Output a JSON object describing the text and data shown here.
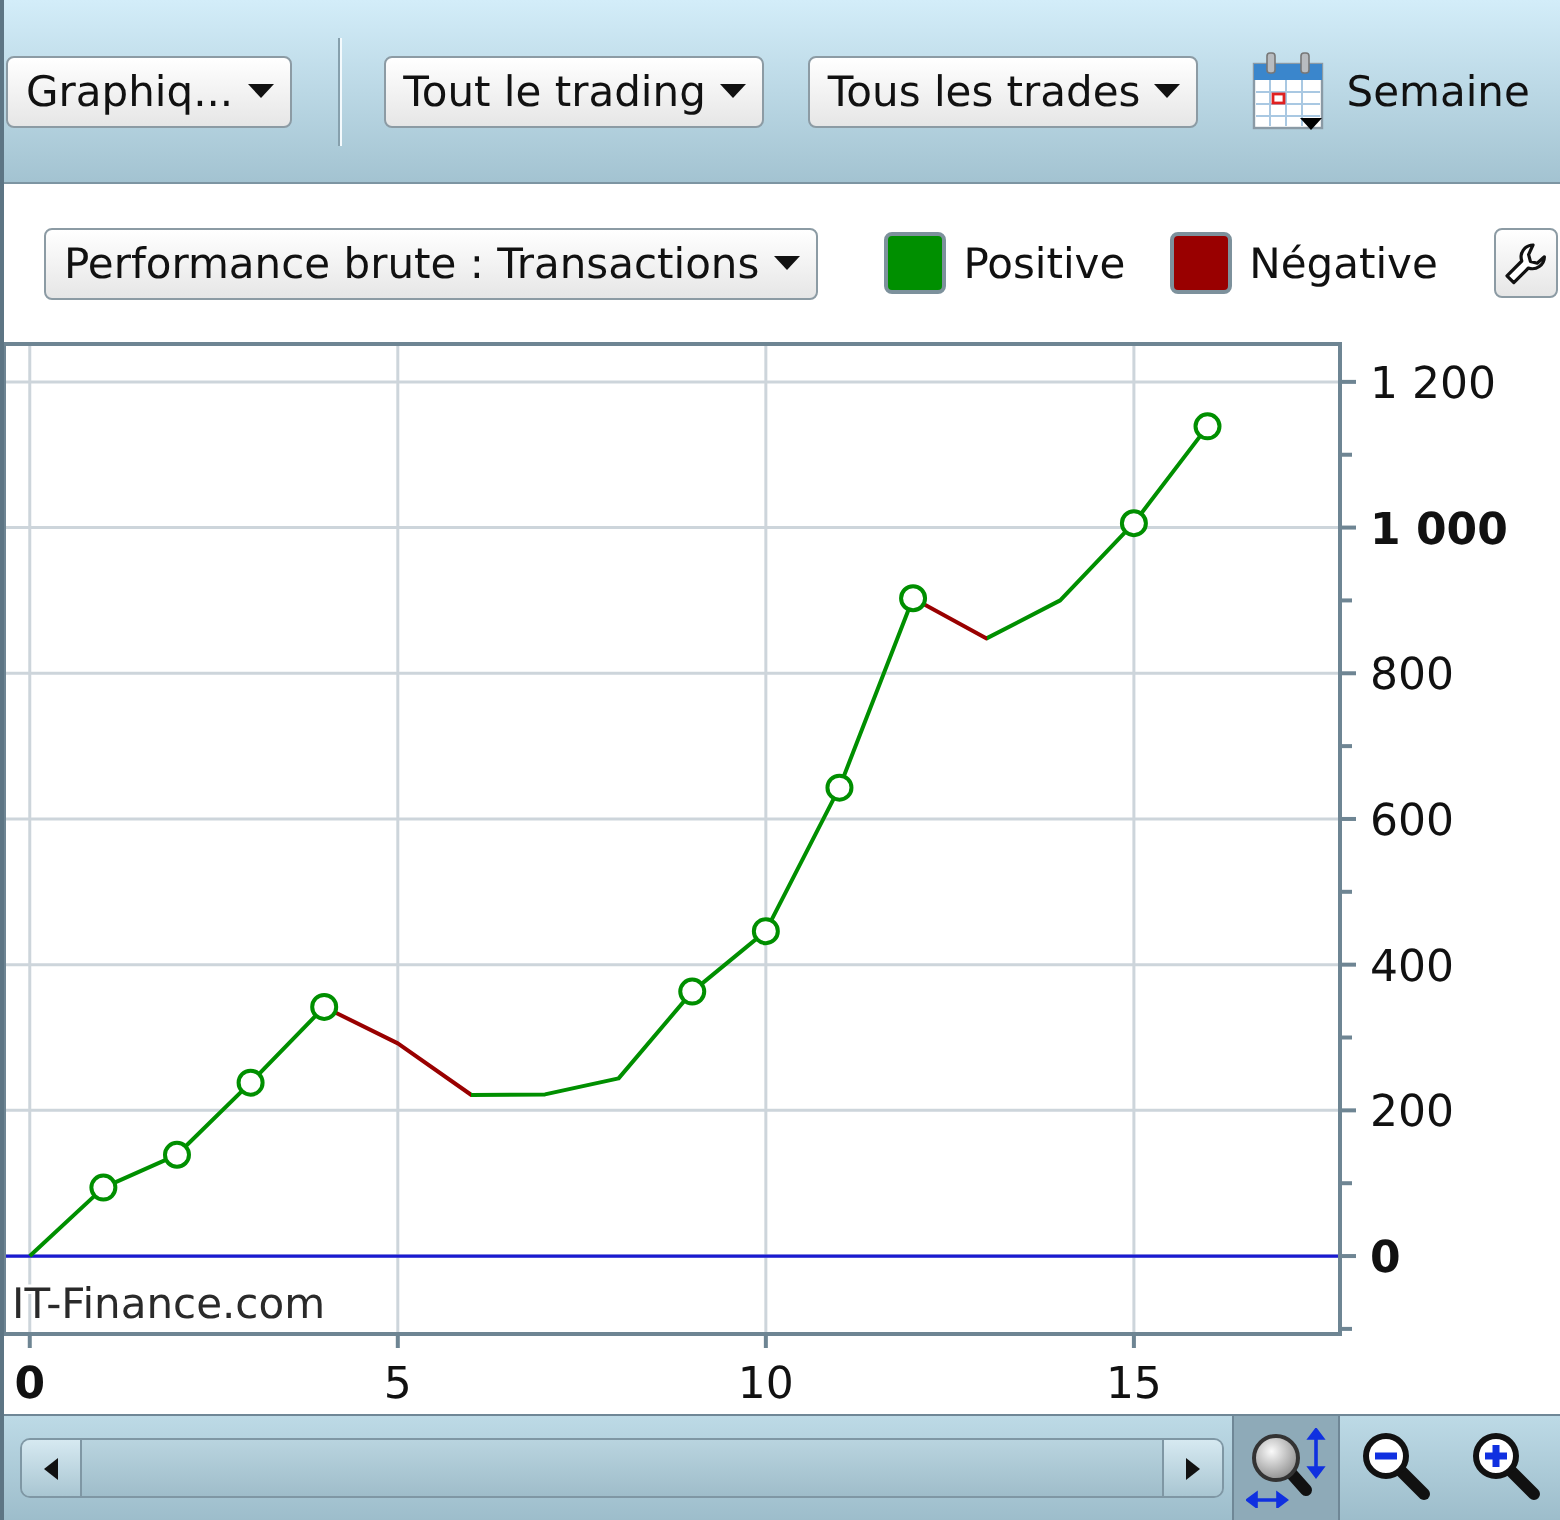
{
  "toolbar": {
    "view_menu": {
      "label": "Graphiq..."
    },
    "filters": [
      {
        "label": "Tout le trading"
      },
      {
        "label": "Tous les trades"
      }
    ],
    "period": {
      "label": "Semaine"
    }
  },
  "chart_controls": {
    "metric_menu": {
      "label": "Performance brute : Transactions"
    },
    "legend": [
      {
        "label": "Positive",
        "color": "#008f00"
      },
      {
        "label": "Négative",
        "color": "#990000"
      }
    ]
  },
  "chart": {
    "brand_label": "IT-Finance.com",
    "chart_data": {
      "type": "line",
      "x": [
        0,
        1,
        2,
        3,
        4,
        5,
        6,
        7,
        8,
        9,
        10,
        11,
        12,
        13,
        14,
        15,
        16
      ],
      "series": [
        {
          "values": [
            0,
            94,
            139,
            238,
            342,
            292,
            221,
            222,
            244,
            363,
            446,
            643,
            903,
            848,
            900,
            1006,
            1139
          ]
        }
      ],
      "xlim": [
        -0.35,
        17.8
      ],
      "ylim": [
        -107,
        1252
      ],
      "xticks": [
        0,
        5,
        10,
        15
      ],
      "yticks": [
        {
          "value": 0,
          "label": "0"
        },
        {
          "value": 200,
          "label": "200"
        },
        {
          "value": 400,
          "label": "400"
        },
        {
          "value": 600,
          "label": "600"
        },
        {
          "value": 800,
          "label": "800"
        },
        {
          "value": 1000,
          "label": "1 000"
        },
        {
          "value": 1200,
          "label": "1 200"
        }
      ],
      "grid": true,
      "ref_lines": [
        {
          "axis": "y",
          "value": 0,
          "color": "#1a1ad0"
        }
      ]
    }
  },
  "bottom_bar": {
    "zoom_tools": [
      {
        "kind": "fit",
        "selected": true
      },
      {
        "kind": "zoom_out",
        "selected": false
      },
      {
        "kind": "zoom_in",
        "selected": false
      }
    ]
  }
}
